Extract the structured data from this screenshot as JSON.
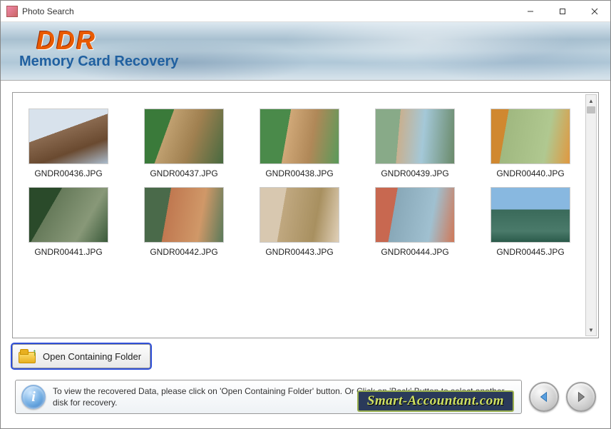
{
  "window": {
    "title": "Photo Search"
  },
  "banner": {
    "logo": "DDR",
    "subtitle": "Memory Card Recovery"
  },
  "thumbs": [
    {
      "label": "GNDR00436.JPG",
      "cls": "ph1"
    },
    {
      "label": "GNDR00437.JPG",
      "cls": "ph2"
    },
    {
      "label": "GNDR00438.JPG",
      "cls": "ph3"
    },
    {
      "label": "GNDR00439.JPG",
      "cls": "ph4"
    },
    {
      "label": "GNDR00440.JPG",
      "cls": "ph5"
    },
    {
      "label": "GNDR00441.JPG",
      "cls": "ph6"
    },
    {
      "label": "GNDR00442.JPG",
      "cls": "ph7"
    },
    {
      "label": "GNDR00443.JPG",
      "cls": "ph8"
    },
    {
      "label": "GNDR00444.JPG",
      "cls": "ph9"
    },
    {
      "label": "GNDR00445.JPG",
      "cls": "ph10"
    }
  ],
  "buttons": {
    "open_containing": "Open Containing Folder"
  },
  "info": {
    "text": "To view the recovered Data, please click on 'Open Containing Folder' button. Or Click on 'Back' Button to select another disk for recovery."
  },
  "watermark": "Smart-Accountant.com"
}
